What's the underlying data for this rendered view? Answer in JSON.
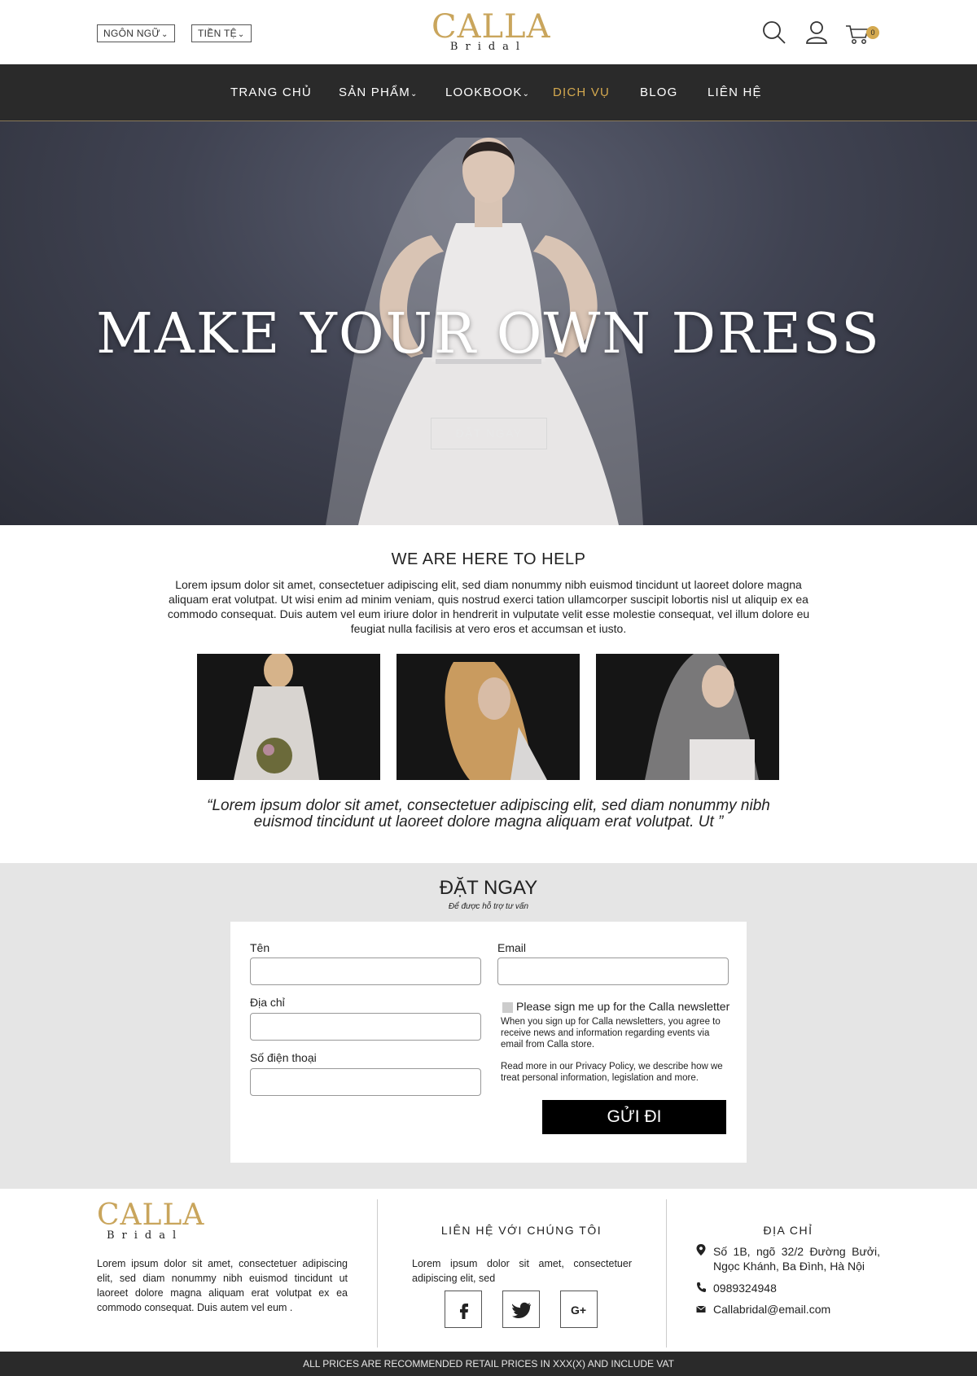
{
  "header": {
    "language_label": "NGÔN NGỮ",
    "currency_label": "TIỀN TỆ",
    "logo_main": "CALLA",
    "logo_sub": "Bridal",
    "cart_count": "0",
    "icons": [
      "search-icon",
      "user-icon",
      "cart-icon"
    ],
    "accent_color": "#d4a94f"
  },
  "nav": {
    "items": [
      {
        "label": "TRANG CHỦ",
        "dropdown": false
      },
      {
        "label": "SẢN PHẨM",
        "dropdown": true
      },
      {
        "label": "LOOKBOOK",
        "dropdown": true
      },
      {
        "label": "DỊCH VỤ",
        "dropdown": false,
        "active": true
      },
      {
        "label": "BLOG",
        "dropdown": false
      },
      {
        "label": "LIÊN HỆ",
        "dropdown": false
      }
    ]
  },
  "hero": {
    "title": "MAKE YOUR OWN DRESS",
    "cta": "ĐẶT NGAY"
  },
  "help": {
    "title": "WE ARE HERE TO HELP",
    "text": "Lorem ipsum dolor sit amet, consectetuer adipiscing elit, sed diam nonummy nibh euismod tincidunt ut laoreet dolore magna aliquam erat volutpat. Ut wisi enim ad minim veniam, quis nostrud exerci tation ullamcorper suscipit lobortis nisl ut aliquip ex ea commodo consequat. Duis autem vel eum iriure dolor in hendrerit in vulputate velit esse molestie consequat, vel illum dolore eu feugiat nulla facilisis at vero eros et accumsan et iusto.",
    "quote": "“Lorem ipsum dolor sit amet, consectetuer adipiscing elit, sed diam nonummy nibh euismod tincidunt ut laoreet dolore magna aliquam erat volutpat. Ut ”"
  },
  "booking": {
    "title": "ĐẶT NGAY",
    "subtitle": "Để được hỗ trợ tư vấn",
    "fields": {
      "name_label": "Tên",
      "address_label": "Địa chỉ",
      "phone_label": "Số điện thoại",
      "email_label": "Email",
      "name_value": "",
      "address_value": "",
      "phone_value": "",
      "email_value": ""
    },
    "newsletter_label": "Please sign me up for the Calla newsletter",
    "newsletter_checked": false,
    "note1": "When you sign up for Calla newsletters, you agree to receive news and information regarding events via email from Calla store.",
    "note2": "Read more in our Privacy Policy, we describe how we treat personal information, legislation and more.",
    "submit_label": "GỬI ĐI"
  },
  "footer": {
    "logo_main": "CALLA",
    "logo_sub": "Bridal",
    "about": "Lorem ipsum dolor sit amet, consectetuer adipiscing elit, sed diam nonummy nibh euismod tincidunt ut laoreet dolore magna aliquam erat volutpat ex ea commodo consequat. Duis autem vel eum .",
    "contact_heading": "LIÊN HỆ VỚI CHÚNG TÔI",
    "contact_text": "Lorem ipsum dolor sit amet, consectetuer adipiscing elit, sed",
    "social": [
      "facebook-icon",
      "twitter-icon",
      "google-plus-icon"
    ],
    "address_heading": "ĐỊA CHỈ",
    "address": "Số 1B, ngõ 32/2 Đường Bưởi, Ngọc Khánh, Ba Đình, Hà Nội",
    "phone": "0989324948",
    "email": "Callabridal@email.com",
    "disclaimer": "ALL PRICES ARE RECOMMENDED RETAIL PRICES IN XXX(X) AND INCLUDE VAT"
  }
}
